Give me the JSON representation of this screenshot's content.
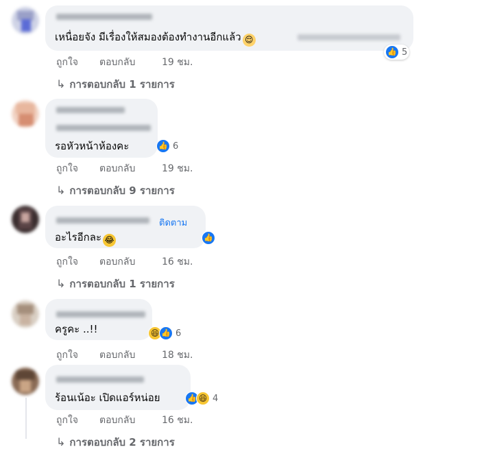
{
  "comments": [
    {
      "text": "เหนื่อยจัง มีเรื่องให้สมองต้องทำงานอีกแล้ว",
      "emoji": "😌",
      "reaction_count": "5",
      "actions": {
        "like": "ถูกใจ",
        "reply": "ตอบกลับ",
        "time": "19 ชม."
      },
      "replies_label": "การตอบกลับ 1 รายการ"
    },
    {
      "text": "รอหัวหน้าห้องคะ",
      "reaction_count": "6",
      "actions": {
        "like": "ถูกใจ",
        "reply": "ตอบกลับ",
        "time": "19 ชม."
      },
      "replies_label": "การตอบกลับ 9 รายการ"
    },
    {
      "text": "อะไรอีกละ",
      "emoji": "😂",
      "follow_label": "ติดตาม",
      "actions": {
        "like": "ถูกใจ",
        "reply": "ตอบกลับ",
        "time": "16 ชม."
      },
      "replies_label": "การตอบกลับ 1 รายการ"
    },
    {
      "text": "ครูคะ ..!!",
      "reaction_count": "6",
      "actions": {
        "like": "ถูกใจ",
        "reply": "ตอบกลับ",
        "time": "18 ชม."
      }
    },
    {
      "text": "ร้อนเน้อะ เปิดแอร์หน่อย",
      "reaction_count": "4",
      "actions": {
        "like": "ถูกใจ",
        "reply": "ตอบกลับ",
        "time": "16 ชม."
      },
      "replies_label": "การตอบกลับ 2 รายการ"
    }
  ],
  "icons": {
    "like": "👍",
    "haha": "😆",
    "reply_arrow": "↳"
  },
  "colors": {
    "link": "#1877f2",
    "bubble": "#f0f2f5",
    "meta": "#65676b"
  }
}
